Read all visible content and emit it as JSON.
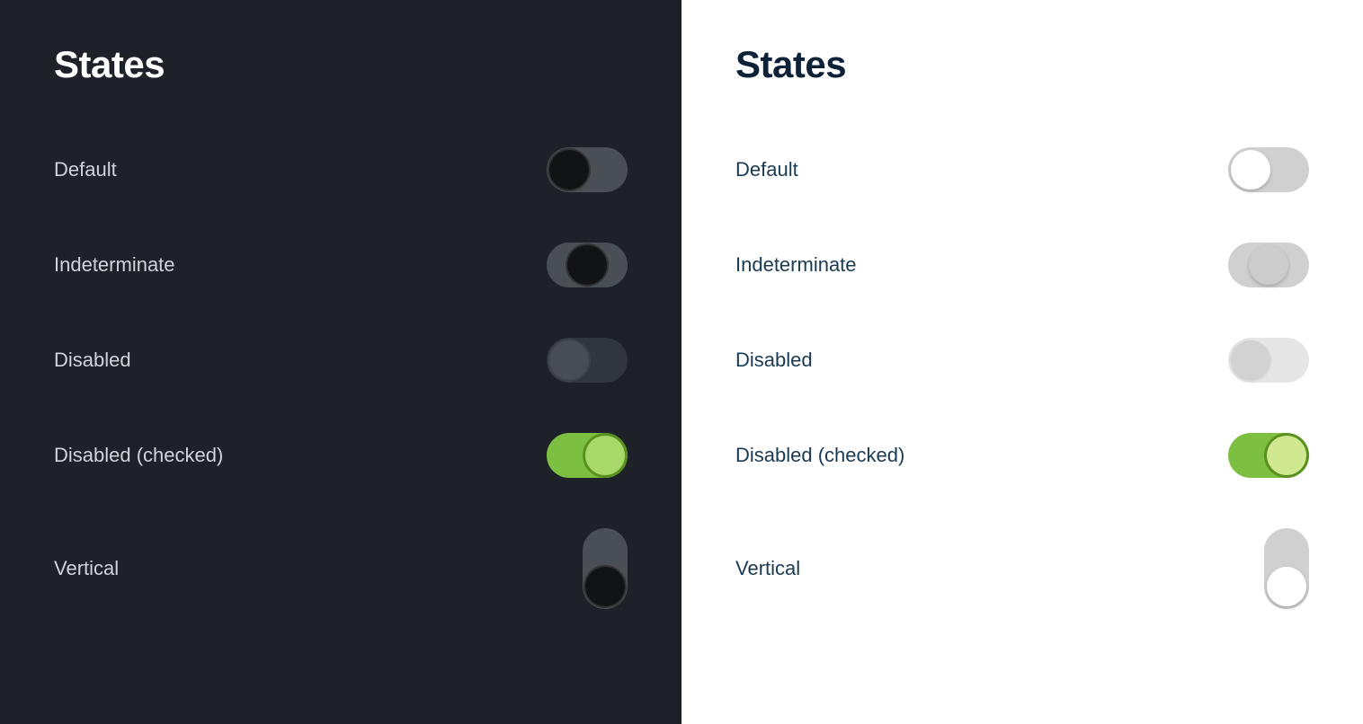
{
  "panels": {
    "dark": {
      "title": "States",
      "theme": "dark",
      "states": [
        {
          "id": "default",
          "label": "Default",
          "toggle_type": "horizontal",
          "toggle_variant": "default-dark"
        },
        {
          "id": "indeterminate",
          "label": "Indeterminate",
          "toggle_type": "horizontal",
          "toggle_variant": "indeterminate-dark"
        },
        {
          "id": "disabled",
          "label": "Disabled",
          "toggle_type": "horizontal",
          "toggle_variant": "disabled-dark"
        },
        {
          "id": "disabled-checked",
          "label": "Disabled (checked)",
          "toggle_type": "horizontal",
          "toggle_variant": "disabled-checked-dark"
        },
        {
          "id": "vertical",
          "label": "Vertical",
          "toggle_type": "vertical",
          "toggle_variant": "vertical-dark"
        }
      ]
    },
    "light": {
      "title": "States",
      "theme": "light",
      "states": [
        {
          "id": "default",
          "label": "Default",
          "toggle_type": "horizontal",
          "toggle_variant": "default-light"
        },
        {
          "id": "indeterminate",
          "label": "Indeterminate",
          "toggle_type": "horizontal",
          "toggle_variant": "indeterminate-light"
        },
        {
          "id": "disabled",
          "label": "Disabled",
          "toggle_type": "horizontal",
          "toggle_variant": "disabled-light"
        },
        {
          "id": "disabled-checked",
          "label": "Disabled (checked)",
          "toggle_type": "horizontal",
          "toggle_variant": "disabled-checked-light"
        },
        {
          "id": "vertical",
          "label": "Vertical",
          "toggle_type": "vertical",
          "toggle_variant": "vertical-light"
        }
      ]
    }
  }
}
